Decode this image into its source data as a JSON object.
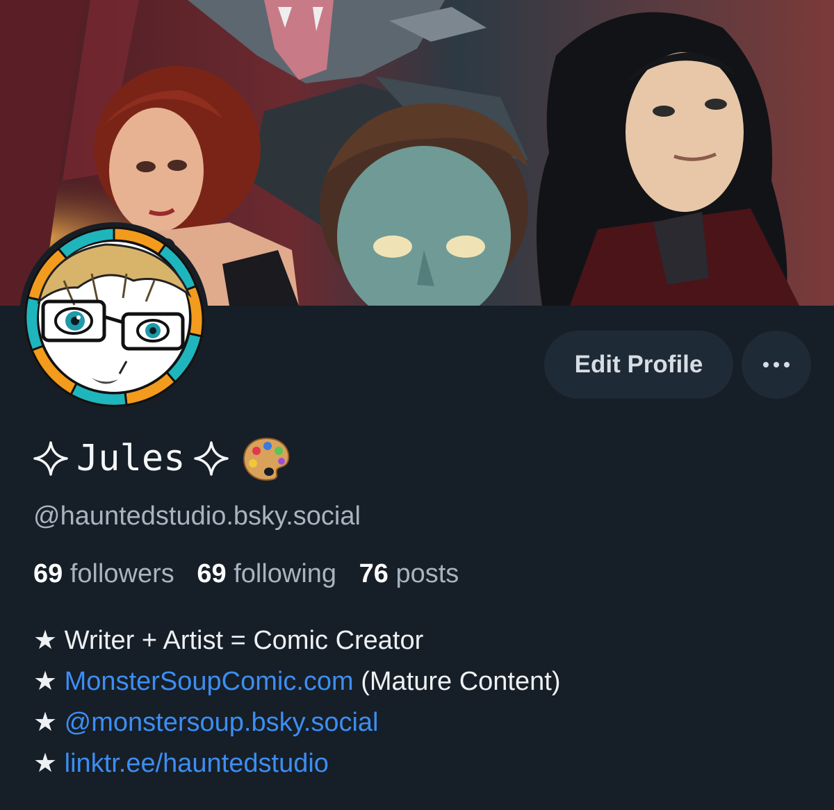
{
  "profile": {
    "display_name": "Jules",
    "handle": "@hauntedstudio.bsky.social"
  },
  "actions": {
    "edit_label": "Edit Profile",
    "more_icon": "more-horizontal-icon"
  },
  "stats": {
    "followers_count": "69",
    "followers_label": "followers",
    "following_count": "69",
    "following_label": "following",
    "posts_count": "76",
    "posts_label": "posts"
  },
  "bio": {
    "bullet": "★",
    "line1": "Writer + Artist = Comic Creator",
    "line2_link": "MonsterSoupComic.com",
    "line2_text": " (Mature Content)",
    "line3_link": "@monstersoup.bsky.social",
    "line4_link": "linktr.ee/hauntedstudio"
  },
  "icons": {
    "name_prefix": "sparkle-icon",
    "name_suffix": "sparkle-icon",
    "name_emoji": "artist-palette-icon"
  },
  "colors": {
    "background": "#161e27",
    "button": "#1f2a37",
    "link": "#3c8ef2",
    "muted_text": "#a9b4c0"
  }
}
